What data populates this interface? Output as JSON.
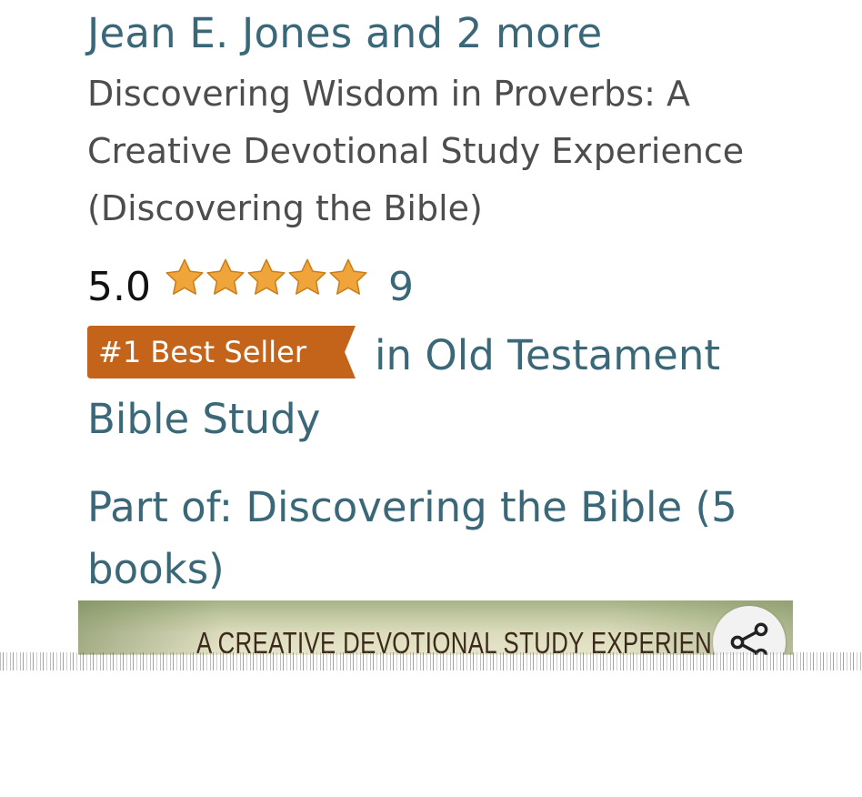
{
  "product": {
    "authors_link": "Jean E. Jones and 2 more",
    "title": "Discovering Wisdom in Proverbs: A Creative Devotional Study Experience (Discovering the Bible)",
    "rating": {
      "value_text": "5.0",
      "stars": 5.0,
      "max_stars": 5,
      "count_text": "9",
      "star_color": "#f0a53a"
    },
    "bestseller": {
      "badge_label": "#1 Best Seller",
      "category_link": "in Old Testament Bible Study",
      "badge_color": "#c4641b"
    },
    "series_link": "Part of: Discovering the Bible (5 books)",
    "cover": {
      "visible_text": "A CREATIVE DEVOTIONAL STUDY EXPERIENCE"
    },
    "share_icon": "share-icon"
  },
  "colors": {
    "link": "#3a6879",
    "title_text": "#4d4d4d"
  }
}
